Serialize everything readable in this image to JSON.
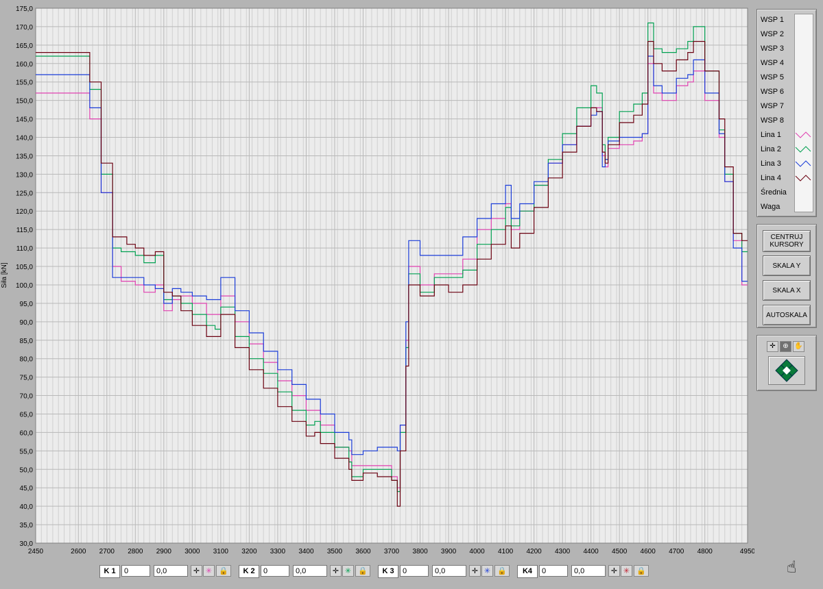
{
  "chart_data": {
    "type": "line",
    "ylabel": "Siła [kN]",
    "xlabel": "",
    "xlim": [
      2450,
      4950
    ],
    "ylim": [
      30,
      175
    ],
    "x_ticks": [
      2450,
      2600,
      2700,
      2800,
      2900,
      3000,
      3100,
      3200,
      3300,
      3400,
      3500,
      3600,
      3700,
      3800,
      3900,
      4000,
      4100,
      4200,
      4300,
      4400,
      4500,
      4600,
      4700,
      4800,
      4950
    ],
    "x_tick_labels": [
      "2450",
      "2600",
      "2700",
      "2800",
      "2900",
      "3000",
      "3100",
      "3200",
      "3300",
      "3400",
      "3500",
      "3600",
      "3700",
      "3800",
      "3900",
      "4000",
      "4100",
      "4200",
      "4300",
      "4400",
      "4500",
      "4600",
      "4700",
      "4800",
      "4950"
    ],
    "y_ticks": [
      30,
      35,
      40,
      45,
      50,
      55,
      60,
      65,
      70,
      75,
      80,
      85,
      90,
      95,
      100,
      105,
      110,
      115,
      120,
      125,
      130,
      135,
      140,
      145,
      150,
      155,
      160,
      165,
      170,
      175
    ],
    "y_tick_labels": [
      "30,0",
      "35,0",
      "40,0",
      "45,0",
      "50,0",
      "55,0",
      "60,0",
      "65,0",
      "70,0",
      "75,0",
      "80,0",
      "85,0",
      "90,0",
      "95,0",
      "100,0",
      "105,0",
      "110,0",
      "115,0",
      "120,0",
      "125,0",
      "130,0",
      "135,0",
      "140,0",
      "145,0",
      "150,0",
      "155,0",
      "160,0",
      "165,0",
      "170,0",
      "175,0"
    ],
    "grid": true,
    "series": [
      {
        "name": "Lina 1",
        "color": "#e040b0",
        "x": [
          2450,
          2600,
          2640,
          2680,
          2720,
          2750,
          2770,
          2800,
          2830,
          2870,
          2900,
          2930,
          2960,
          3000,
          3050,
          3080,
          3100,
          3150,
          3200,
          3250,
          3300,
          3350,
          3400,
          3430,
          3450,
          3500,
          3550,
          3560,
          3600,
          3650,
          3700,
          3720,
          3730,
          3750,
          3760,
          3800,
          3850,
          3900,
          3950,
          4000,
          4050,
          4100,
          4120,
          4150,
          4200,
          4250,
          4300,
          4350,
          4400,
          4420,
          4440,
          4450,
          4460,
          4500,
          4550,
          4580,
          4600,
          4620,
          4650,
          4700,
          4740,
          4760,
          4800,
          4850,
          4870,
          4900,
          4930,
          4950
        ],
        "y": [
          152,
          152,
          145,
          125,
          105,
          101,
          101,
          100,
          98,
          100,
          93,
          96,
          97,
          95,
          92,
          92,
          97,
          90,
          84,
          79,
          74,
          70,
          66,
          66,
          62,
          56,
          55,
          51,
          51,
          51,
          48,
          45,
          62,
          85,
          105,
          100,
          103,
          103,
          107,
          115,
          118,
          122,
          115,
          120,
          127,
          133,
          138,
          143,
          148,
          148,
          135,
          132,
          137,
          138,
          139,
          141,
          160,
          152,
          150,
          154,
          155,
          158,
          150,
          140,
          128,
          112,
          100,
          100
        ]
      },
      {
        "name": "Lina 2",
        "color": "#00a050",
        "x": [
          2450,
          2600,
          2640,
          2680,
          2720,
          2750,
          2770,
          2800,
          2830,
          2870,
          2900,
          2930,
          2960,
          3000,
          3050,
          3080,
          3100,
          3150,
          3200,
          3250,
          3300,
          3350,
          3400,
          3430,
          3450,
          3500,
          3550,
          3560,
          3600,
          3650,
          3700,
          3720,
          3730,
          3750,
          3760,
          3800,
          3850,
          3900,
          3950,
          4000,
          4050,
          4100,
          4120,
          4150,
          4200,
          4250,
          4300,
          4350,
          4400,
          4420,
          4440,
          4450,
          4460,
          4500,
          4550,
          4580,
          4600,
          4620,
          4650,
          4700,
          4740,
          4760,
          4800,
          4850,
          4870,
          4900,
          4930,
          4950
        ],
        "y": [
          162,
          162,
          153,
          130,
          110,
          109,
          109,
          108,
          106,
          108,
          96,
          97,
          95,
          92,
          89,
          88,
          94,
          86,
          80,
          76,
          71,
          66,
          62,
          63,
          60,
          56,
          52,
          48,
          50,
          50,
          47,
          44,
          60,
          83,
          103,
          98,
          102,
          102,
          104,
          111,
          115,
          121,
          116,
          120,
          127,
          134,
          141,
          148,
          154,
          152,
          138,
          134,
          140,
          147,
          149,
          152,
          171,
          164,
          163,
          164,
          166,
          170,
          158,
          142,
          130,
          114,
          109,
          109
        ]
      },
      {
        "name": "Lina 3",
        "color": "#1a3cd8",
        "x": [
          2450,
          2600,
          2640,
          2680,
          2720,
          2750,
          2770,
          2800,
          2830,
          2870,
          2900,
          2930,
          2960,
          3000,
          3050,
          3080,
          3100,
          3150,
          3200,
          3250,
          3300,
          3350,
          3400,
          3430,
          3450,
          3500,
          3550,
          3560,
          3600,
          3650,
          3700,
          3720,
          3730,
          3750,
          3760,
          3800,
          3850,
          3900,
          3950,
          4000,
          4050,
          4100,
          4120,
          4150,
          4200,
          4250,
          4300,
          4350,
          4400,
          4420,
          4440,
          4450,
          4460,
          4500,
          4550,
          4580,
          4600,
          4620,
          4650,
          4700,
          4740,
          4760,
          4800,
          4850,
          4870,
          4900,
          4930,
          4950
        ],
        "y": [
          157,
          157,
          148,
          125,
          102,
          102,
          102,
          102,
          100,
          99,
          95,
          99,
          98,
          97,
          96,
          96,
          102,
          93,
          87,
          82,
          77,
          73,
          69,
          69,
          65,
          60,
          58,
          54,
          55,
          56,
          56,
          55,
          62,
          90,
          112,
          108,
          108,
          108,
          113,
          118,
          122,
          127,
          118,
          122,
          128,
          133,
          138,
          143,
          146,
          147,
          132,
          134,
          139,
          140,
          140,
          141,
          162,
          154,
          152,
          156,
          157,
          161,
          152,
          141,
          128,
          110,
          101,
          101
        ]
      },
      {
        "name": "Lina 4",
        "color": "#6a0010",
        "x": [
          2450,
          2600,
          2640,
          2680,
          2720,
          2750,
          2770,
          2800,
          2830,
          2870,
          2900,
          2930,
          2960,
          3000,
          3050,
          3080,
          3100,
          3150,
          3200,
          3250,
          3300,
          3350,
          3400,
          3430,
          3450,
          3500,
          3550,
          3560,
          3600,
          3650,
          3700,
          3720,
          3730,
          3750,
          3760,
          3800,
          3850,
          3900,
          3950,
          4000,
          4050,
          4100,
          4120,
          4150,
          4200,
          4250,
          4300,
          4350,
          4400,
          4420,
          4440,
          4450,
          4460,
          4500,
          4550,
          4580,
          4600,
          4620,
          4650,
          4700,
          4740,
          4760,
          4800,
          4850,
          4870,
          4900,
          4930,
          4950
        ],
        "y": [
          163,
          163,
          155,
          133,
          113,
          113,
          111,
          110,
          108,
          109,
          98,
          97,
          93,
          89,
          86,
          86,
          92,
          83,
          77,
          72,
          67,
          63,
          59,
          60,
          57,
          53,
          50,
          47,
          49,
          48,
          47,
          40,
          55,
          78,
          100,
          97,
          100,
          98,
          100,
          107,
          111,
          116,
          110,
          114,
          121,
          129,
          136,
          143,
          148,
          147,
          136,
          133,
          138,
          144,
          146,
          149,
          166,
          160,
          158,
          161,
          163,
          166,
          158,
          145,
          132,
          114,
          112,
          112
        ]
      }
    ]
  },
  "legend": {
    "rows": [
      "WSP 1",
      "WSP 2",
      "WSP 3",
      "WSP 4",
      "WSP 5",
      "WSP 6",
      "WSP 7",
      "WSP 8",
      "Lina 1",
      "Lina 2",
      "Lina 3",
      "Lina 4",
      "Średnia",
      "Waga"
    ],
    "swatch_colors": {
      "Lina 1": "#e040b0",
      "Lina 2": "#00a050",
      "Lina 3": "#1a3cd8",
      "Lina 4": "#6a0010"
    }
  },
  "buttons": {
    "centruj": "CENTRUJ KURSORY",
    "skala_y": "SKALA Y",
    "skala_x": "SKALA X",
    "autoskala": "AUTOSKALA"
  },
  "cursors": [
    {
      "label": "K 1",
      "x": "0",
      "y": "0,0",
      "color": "#e040b0"
    },
    {
      "label": "K 2",
      "x": "0",
      "y": "0,0",
      "color": "#00a050"
    },
    {
      "label": "K 3",
      "x": "0",
      "y": "0,0",
      "color": "#1a3cd8"
    },
    {
      "label": "K4",
      "x": "0",
      "y": "0,0",
      "color": "#c02030"
    }
  ],
  "colors": {
    "plot_bg": "#ececec",
    "grid": "#bcbcbc",
    "frame": "#b4b4b4"
  }
}
